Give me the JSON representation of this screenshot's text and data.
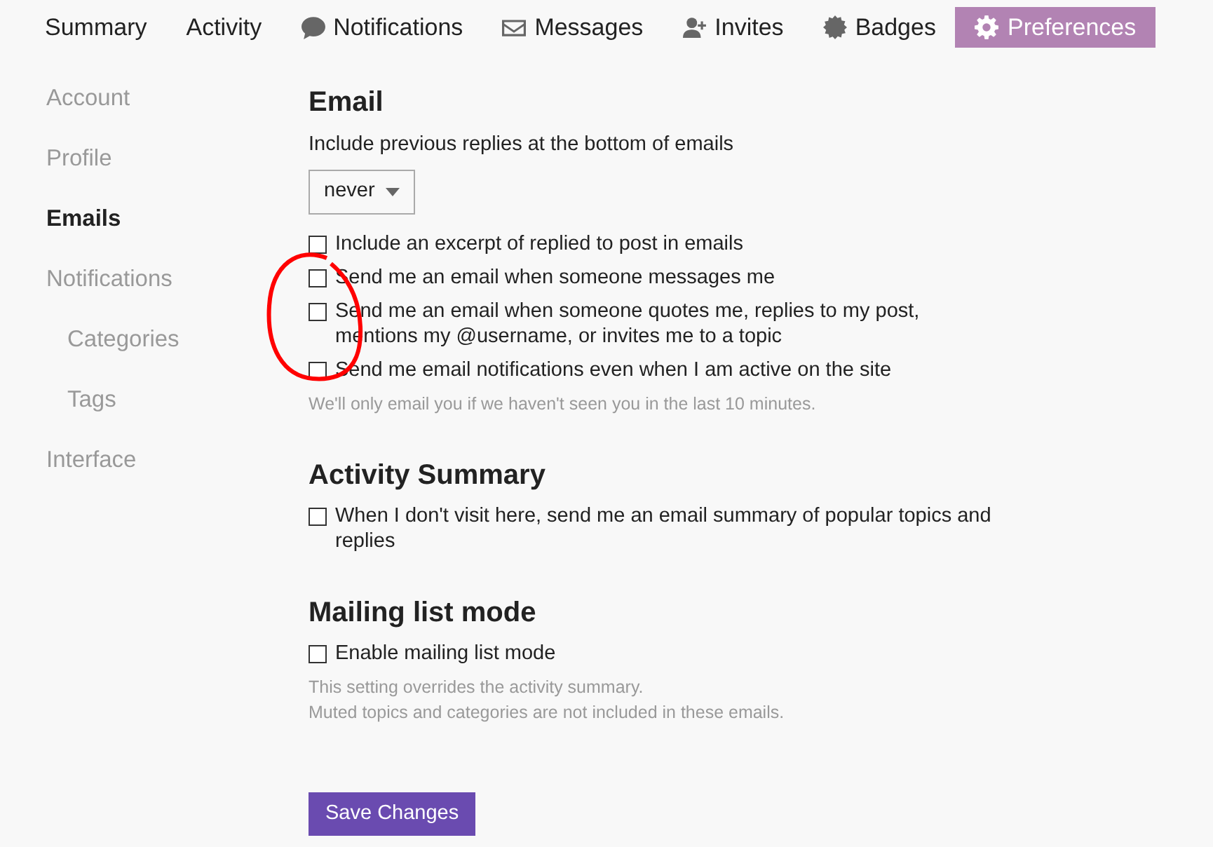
{
  "tabs": [
    {
      "label": "Summary",
      "selected": false
    },
    {
      "label": "Activity",
      "selected": false
    },
    {
      "label": "Notifications",
      "selected": false
    },
    {
      "label": "Messages",
      "selected": false
    },
    {
      "label": "Invites",
      "selected": false
    },
    {
      "label": "Badges",
      "selected": false
    },
    {
      "label": "Preferences",
      "selected": true
    }
  ],
  "sidebar": {
    "items": [
      {
        "label": "Account",
        "selected": false
      },
      {
        "label": "Profile",
        "selected": false
      },
      {
        "label": "Emails",
        "selected": true
      },
      {
        "label": "Notifications",
        "selected": false,
        "children": [
          {
            "label": "Categories",
            "selected": false
          },
          {
            "label": "Tags",
            "selected": false
          }
        ]
      },
      {
        "label": "Interface",
        "selected": false
      }
    ]
  },
  "sections": [
    {
      "title": "Email",
      "select": {
        "label": "Include previous replies at the bottom of emails",
        "value": "never"
      },
      "checkboxes": [
        {
          "label": "Include an excerpt of replied to post in emails",
          "checked": false
        },
        {
          "label": "Send me an email when someone messages me",
          "checked": false
        },
        {
          "label": "Send me an email when someone quotes me, replies to my post, mentions my @username, or invites me to a topic",
          "checked": false
        },
        {
          "label": "Send me email notifications even when I am active on the site",
          "checked": false
        }
      ],
      "notes": [
        "We'll only email you if we haven't seen you in the last 10 minutes."
      ]
    },
    {
      "title": "Activity Summary",
      "checkboxes": [
        {
          "label": "When I don't visit here, send me an email summary of popular topics and replies",
          "checked": false
        }
      ]
    },
    {
      "title": "Mailing list mode",
      "checkboxes": [
        {
          "label": "Enable mailing list mode",
          "checked": false
        }
      ],
      "notes": [
        "This setting overrides the activity summary.",
        "Muted topics and categories are not included in these emails."
      ]
    }
  ],
  "save_button": "Save Changes"
}
